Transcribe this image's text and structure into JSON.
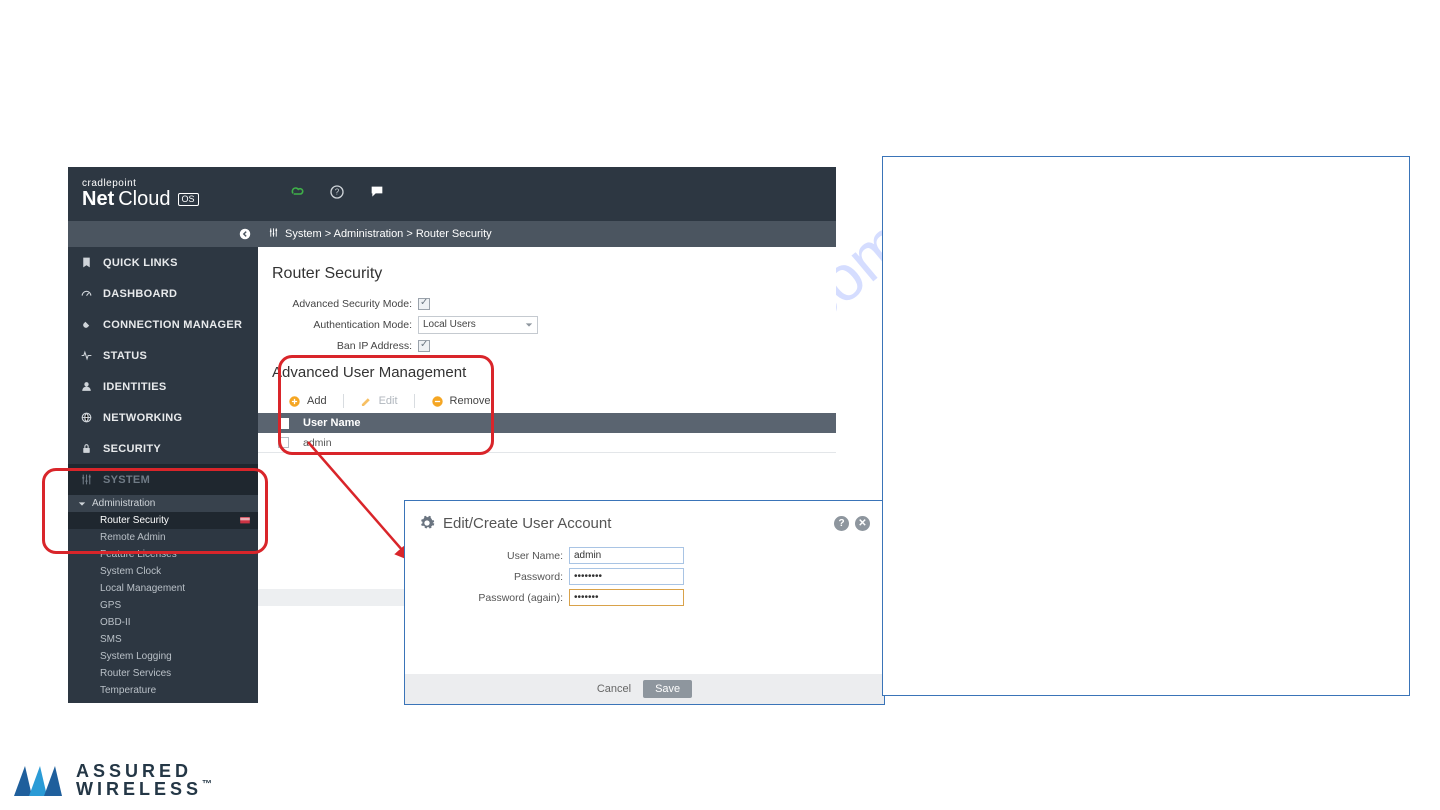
{
  "brand": {
    "top": "cradlepoint",
    "name1": "Net",
    "name2": "Cloud",
    "suffix": "OS"
  },
  "breadcrumb": "System > Administration > Router Security",
  "sidebar": {
    "primary": [
      {
        "label": "QUICK LINKS"
      },
      {
        "label": "DASHBOARD"
      },
      {
        "label": "CONNECTION MANAGER"
      },
      {
        "label": "STATUS"
      },
      {
        "label": "IDENTITIES"
      },
      {
        "label": "NETWORKING"
      },
      {
        "label": "SECURITY"
      },
      {
        "label": "SYSTEM"
      }
    ],
    "group": "Administration",
    "sub": [
      {
        "label": "Router Security"
      },
      {
        "label": "Remote Admin"
      },
      {
        "label": "Feature Licenses"
      },
      {
        "label": "System Clock"
      },
      {
        "label": "Local Management"
      },
      {
        "label": "GPS"
      },
      {
        "label": "OBD-II"
      },
      {
        "label": "SMS"
      },
      {
        "label": "System Logging"
      },
      {
        "label": "Router Services"
      },
      {
        "label": "Temperature"
      }
    ]
  },
  "page": {
    "title": "Router Security",
    "fields": {
      "advSecMode": "Advanced Security Mode:",
      "authMode": "Authentication Mode:",
      "authModeValue": "Local Users",
      "banIp": "Ban IP Address:"
    },
    "section": "Advanced User Management",
    "toolbar": {
      "add": "Add",
      "edit": "Edit",
      "remove": "Remove"
    },
    "table": {
      "header": "User Name",
      "rows": [
        "admin"
      ]
    }
  },
  "dialog": {
    "title": "Edit/Create User Account",
    "rows": {
      "username_label": "User Name:",
      "username_value": "admin",
      "password_label": "Password:",
      "password_value": "••••••••",
      "password2_label": "Password (again):",
      "password2_value": "•••••••"
    },
    "cancel": "Cancel",
    "save": "Save"
  },
  "watermark": "manualshive.com",
  "logo": {
    "line1": "ASSURED",
    "line2": "WIRELESS",
    "tm": "™"
  }
}
